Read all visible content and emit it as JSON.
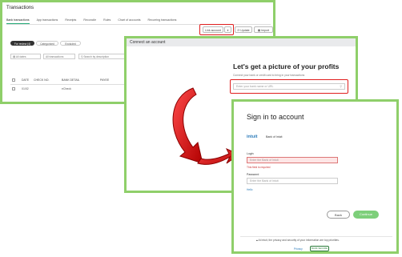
{
  "transactions": {
    "title": "Transactions",
    "tabs": [
      "Bank transactions",
      "App transactions",
      "Receipts",
      "Reconcile",
      "Rules",
      "Chart of accounts",
      "Recurring transactions"
    ],
    "link_account_label": "Link account",
    "update_label": "Update",
    "import_label": "Import",
    "filters": [
      "For review (4)",
      "Categorized",
      "Excluded"
    ],
    "date_select": "All dates",
    "transactions_select": "All transactions",
    "search_placeholder": "Search by description",
    "columns": [
      "DATE",
      "CHECK NO.",
      "BANK DETAIL",
      "PAYEE"
    ],
    "row": {
      "date": "01/02",
      "detail": "eCheck"
    }
  },
  "connect": {
    "window_title": "Connect an account",
    "heading": "Let's get a picture of your profits",
    "subtitle": "Connect your bank or credit card to bring in your transactions",
    "search_placeholder": "Enter your bank name or URL"
  },
  "signin": {
    "heading": "Sign in to account",
    "logo_text": "intuit",
    "bank_name": "Bank of Intuit",
    "login_label": "Login",
    "login_placeholder": "Enter the Bank of Intuit",
    "login_error": "This field is required",
    "password_label": "Password",
    "password_placeholder": "Enter the Bank of Intuit",
    "help_link": "Hello",
    "back_label": "Back",
    "continue_label": "Continue",
    "privacy_text": "At Intuit, the privacy and security of your information are top priorities.",
    "privacy_link": "Privacy",
    "badge_text": "BANK SECURE"
  },
  "colors": {
    "frame_green": "#8fcf6a",
    "highlight_red": "#e01e1e",
    "continue_green": "#7dcf7a"
  }
}
